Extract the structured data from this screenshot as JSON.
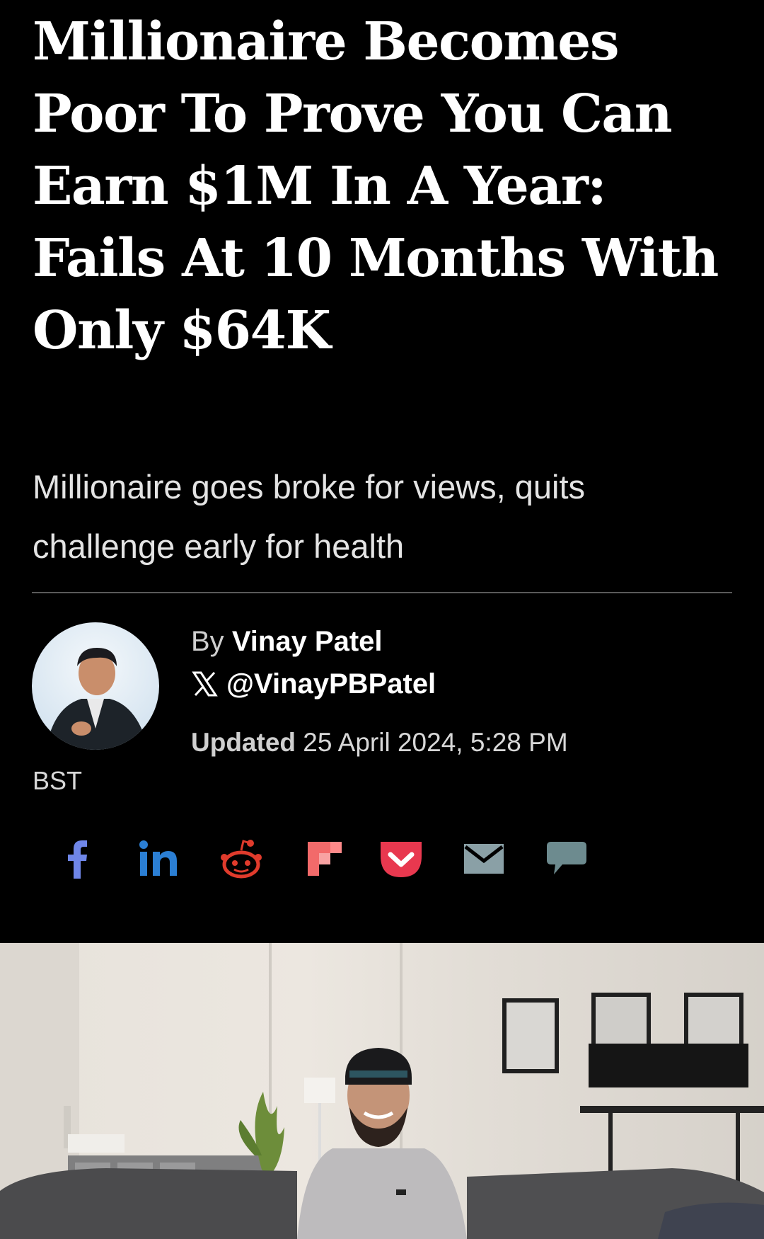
{
  "article": {
    "headline": "Millionaire Becomes Poor To Prove You Can Earn $1M In A Year: Fails At 10 Months With Only $64K",
    "subtitle": "Millionaire goes broke for views, quits challenge early for health"
  },
  "author": {
    "by_label": "By",
    "name": "Vinay Patel",
    "x_handle": "@VinayPBPatel"
  },
  "meta": {
    "updated_label": "Updated",
    "updated_value": "25 April 2024, 5:28 PM",
    "timezone": "BST"
  },
  "share": {
    "icons": [
      "facebook-icon",
      "linkedin-icon",
      "reddit-icon",
      "flipboard-icon",
      "pocket-icon",
      "email-icon",
      "comment-icon"
    ],
    "colors": {
      "facebook": "#6f86e8",
      "linkedin": "#2b7fd4",
      "reddit": "#e03b2c",
      "flipboard": "#f26a6a",
      "pocket": "#e8384f",
      "email": "#8aa0a6",
      "comment": "#6d8b8f"
    }
  }
}
